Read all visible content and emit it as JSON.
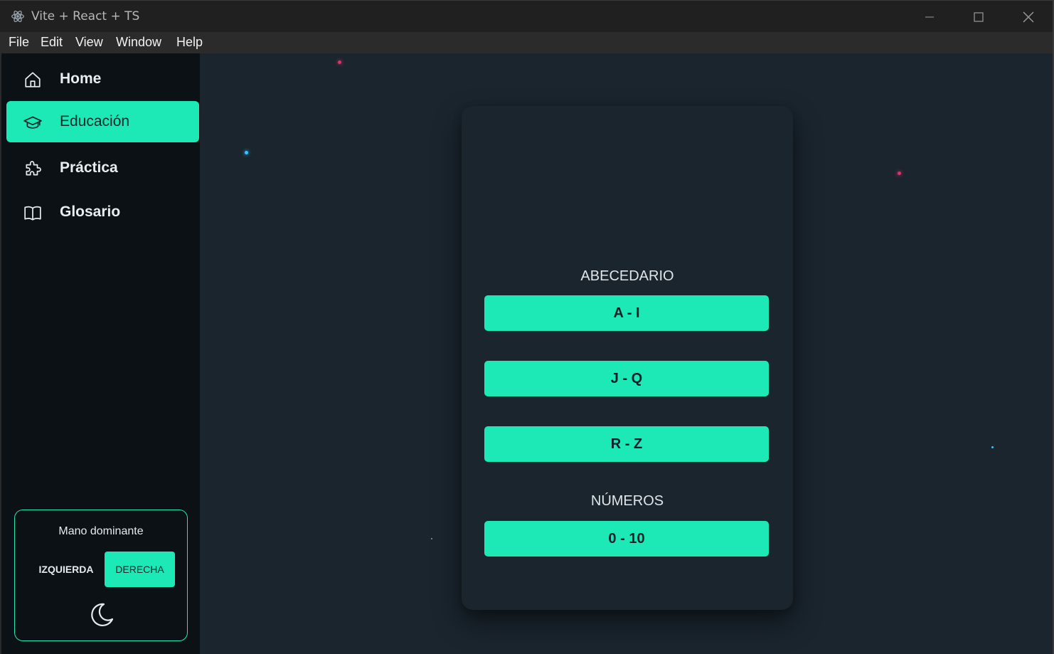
{
  "window": {
    "title": "Vite + React + TS"
  },
  "menu": [
    "File",
    "Edit",
    "View",
    "Window",
    "Help"
  ],
  "sidebar": {
    "items": [
      {
        "label": "Home",
        "icon": "home-icon",
        "active": false
      },
      {
        "label": "Educación",
        "icon": "graduation-cap-icon",
        "active": true
      },
      {
        "label": "Práctica",
        "icon": "puzzle-icon",
        "active": false
      },
      {
        "label": "Glosario",
        "icon": "book-icon",
        "active": false
      }
    ],
    "hand": {
      "title": "Mano dominante",
      "left_label": "IZQUIERDA",
      "right_label": "DERECHA",
      "selected": "DERECHA",
      "theme_icon": "moon-icon"
    }
  },
  "card": {
    "alphabet_title": "ABECEDARIO",
    "alphabet_ranges": [
      "A - I",
      "J - Q",
      "R - Z"
    ],
    "numbers_title": "NÚMEROS",
    "number_ranges": [
      "0 - 10"
    ]
  },
  "colors": {
    "accent": "#1de9b6",
    "background": "#1a252e",
    "sidebar": "#0b1114"
  }
}
